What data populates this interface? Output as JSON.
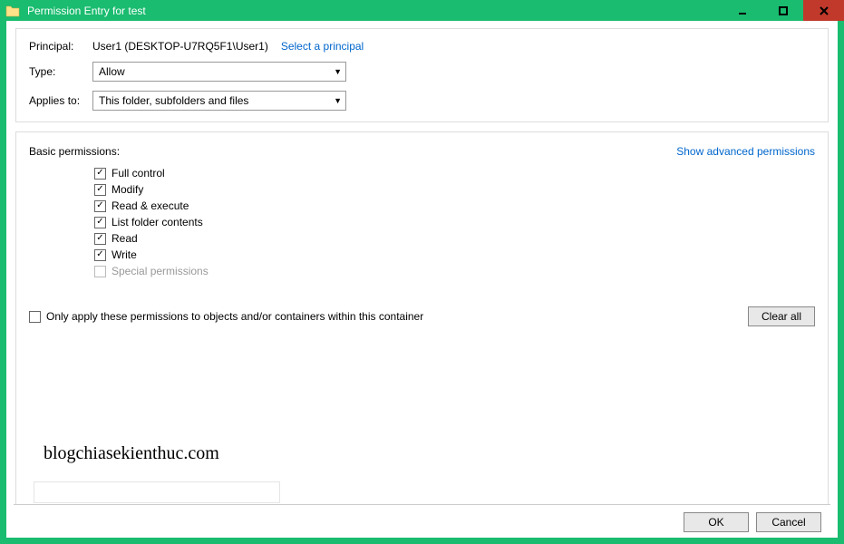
{
  "window": {
    "title": "Permission Entry for test"
  },
  "principal": {
    "label": "Principal:",
    "value": "User1 (DESKTOP-U7RQ5F1\\User1)",
    "link": "Select a principal"
  },
  "type": {
    "label": "Type:",
    "value": "Allow"
  },
  "applies": {
    "label": "Applies to:",
    "value": "This folder, subfolders and files"
  },
  "basic": {
    "title": "Basic permissions:",
    "advanced_link": "Show advanced permissions",
    "permissions": [
      {
        "label": "Full control",
        "checked": true,
        "disabled": false
      },
      {
        "label": "Modify",
        "checked": true,
        "disabled": false
      },
      {
        "label": "Read & execute",
        "checked": true,
        "disabled": false
      },
      {
        "label": "List folder contents",
        "checked": true,
        "disabled": false
      },
      {
        "label": "Read",
        "checked": true,
        "disabled": false
      },
      {
        "label": "Write",
        "checked": true,
        "disabled": false
      },
      {
        "label": "Special permissions",
        "checked": false,
        "disabled": true
      }
    ]
  },
  "only_apply": {
    "label": "Only apply these permissions to objects and/or containers within this container",
    "checked": false
  },
  "buttons": {
    "clear_all": "Clear all",
    "ok": "OK",
    "cancel": "Cancel"
  },
  "watermark": "blogchiasekienthuc.com"
}
